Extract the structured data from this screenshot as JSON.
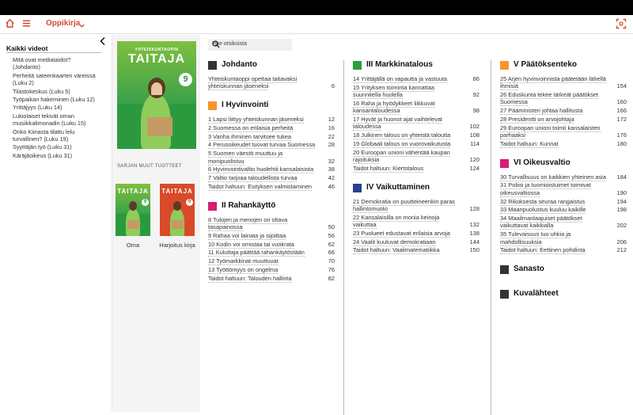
{
  "topbar": {
    "breadcrumb": "Oppikirja",
    "icons": [
      "home-icon",
      "menu-icon",
      "chevron-down-icon",
      "fullscreen-icon"
    ],
    "accent": "#d9482b"
  },
  "sidebar": {
    "title": "Kaikki videot",
    "items": [
      "Mitä ovat mediataidot? (Johdanto)",
      "Perheitä sateenkaarten väreissä (Luku 2)",
      "Tilastokeskus (Luku 5)",
      "Työpaikan hakeminen (Luku 12)",
      "Yrittäjyys (Luku 14)",
      "Lukiolaiset tekivät oman musiikkalimonadin (Luku 15)",
      "Onko Kiinasta tilattu lelu turvallinen? (Luku 19)",
      "Syyttäjän työ (Luku 31)",
      "Käräjäoikeus (Luku 31)"
    ]
  },
  "books": {
    "main_title": "TAITAJA",
    "main_subtitle": "YHTEISKUNTAOPIN",
    "main_badge": "9",
    "series_label": "SARJAN MUUT TUOTTEET",
    "series": [
      {
        "caption": "Oma"
      },
      {
        "caption": "Harjoitus kirja"
      }
    ]
  },
  "search": {
    "placeholder": "Hae otsikoista"
  },
  "toc": {
    "col1": [
      {
        "title": "Johdanto",
        "color": "#333333",
        "entries": [
          {
            "t": "Yhteiskuntaoppi opettaa taitavaksi yhteiskunnan jäseneksi",
            "p": "6"
          }
        ]
      },
      {
        "title": "I Hyvinvointi",
        "color": "#f4952b",
        "entries": [
          {
            "t": "1 Lapsi liittyy yhteiskunnan jäseneksi",
            "p": "12"
          },
          {
            "t": "2 Suomessa on erilaisia perheitä",
            "p": "16"
          },
          {
            "t": "3 Vanha ihminen tarvitsee tukea",
            "p": "22"
          },
          {
            "t": "4 Perusoikeudet tuovat turvaa Suomessa",
            "p": "28"
          },
          {
            "t": "5 Suomen väestö muuttuu ja monipuolistuu",
            "p": "32"
          },
          {
            "t": "6 Hyvinvointivaltio huolehtii kansalaisista",
            "p": "38"
          },
          {
            "t": "7 Valtio tarjoaa taloudellista turvaa",
            "p": "42"
          },
          {
            "t": "Taidot haltuun: Esityksen valmistaminen",
            "p": "46"
          }
        ]
      },
      {
        "title": "II Rahankäyttö",
        "color": "#d81b73",
        "entries": [
          {
            "t": "8 Tulojen ja menojen on oltava tasapainossa",
            "p": "50"
          },
          {
            "t": "9 Rahaa voi lainata ja sijoittaa",
            "p": "56"
          },
          {
            "t": "10 Kodin voi omistaa tai vuokrata",
            "p": "62"
          },
          {
            "t": "11 Kuluttaja päättää rahankäytöstään",
            "p": "66"
          },
          {
            "t": "12 Työmarkkinat muuttuvat",
            "p": "70"
          },
          {
            "t": "13 Työttömyys on ongelma",
            "p": "76"
          },
          {
            "t": "Taidot haltuun: Talouden hallinta",
            "p": "82"
          }
        ]
      }
    ],
    "col2": [
      {
        "title": "III Markkinatalous",
        "color": "#2c9e3e",
        "entries": [
          {
            "t": "14 Yrittäjällä on vapautta ja vastuuta",
            "p": "86"
          },
          {
            "t": "15 Yrityksen toiminta kannattaa suunnitella huolella",
            "p": "92"
          },
          {
            "t": "16 Raha ja hyödykkeet liikkuvat kansantaloudessa",
            "p": "98"
          },
          {
            "t": "17 Hyvät ja huonot ajat vaihtelevat taloudessa",
            "p": "102"
          },
          {
            "t": "18 Julkinen talous on yhteistä taloutta",
            "p": "108"
          },
          {
            "t": "19 Globaali talous on vuorovaikutusta",
            "p": "114"
          },
          {
            "t": "20 Euroopan unioni vähentää kaupan rajoituksia",
            "p": "120"
          },
          {
            "t": "Taidot haltuun: Kiertotalous",
            "p": "124"
          }
        ]
      },
      {
        "title": "IV Vaikuttaminen",
        "color": "#2a3f8f",
        "entries": [
          {
            "t": "21 Demokratia on puutteineenkin paras hallintomuoto",
            "p": "128"
          },
          {
            "t": "22 Kansalaisilla on monia keinoja vaikuttaa",
            "p": "132"
          },
          {
            "t": "23 Puolueet edustavat erilaisia arvoja",
            "p": "138"
          },
          {
            "t": "24 Vaalit kuuluvat demokratiaan",
            "p": "144"
          },
          {
            "t": "Taidot haltuun: Vaalimatematiikka",
            "p": "150"
          }
        ]
      }
    ],
    "col3": [
      {
        "title": "V Päätöksenteko",
        "color": "#f4952b",
        "entries": [
          {
            "t": "25 Arjen hyvinvoinnista päätetään lähellä ihmisiä",
            "p": "154"
          },
          {
            "t": "26 Eduskunta tekee tärkeät päätökset Suomessa",
            "p": "160"
          },
          {
            "t": "27 Pääministeri johtaa hallitusta",
            "p": "166"
          },
          {
            "t": "28 Presidentti on arvojohtaja",
            "p": "172"
          },
          {
            "t": "29 Euroopan unioni toimii kansalaisten parhaaksi",
            "p": "176"
          },
          {
            "t": "Taidot haltuun: Kunnat",
            "p": "180"
          }
        ]
      },
      {
        "title": "VI Oikeusvaltio",
        "color": "#d81b73",
        "entries": [
          {
            "t": "30 Turvallisuus on kaikkien yhteinen asia",
            "p": "184"
          },
          {
            "t": "31 Poliisi ja tuomioistuimet toimivat oikeusvaltiossa",
            "p": "190"
          },
          {
            "t": "32 Rikoksesta seuraa rangaistus",
            "p": "194"
          },
          {
            "t": "33 Maanpuolustus kuuluu kaikille",
            "p": "198"
          },
          {
            "t": "34 Maailmanlaajuiset päätökset vaikuttavat kaikkialla",
            "p": "202"
          },
          {
            "t": "35 Tulevaisuus tuo uhkia ja mahdollisuuksia",
            "p": "206"
          },
          {
            "t": "Taidot haltuun: Eettinen pohdinta",
            "p": "212"
          }
        ]
      },
      {
        "title": "Sanasto",
        "color": "#333333",
        "entries": []
      },
      {
        "title": "Kuvalähteet",
        "color": "#333333",
        "entries": []
      }
    ]
  }
}
